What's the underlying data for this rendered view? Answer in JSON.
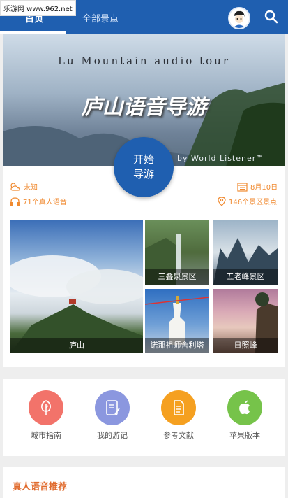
{
  "header": {
    "tabs": [
      {
        "label": "首页"
      },
      {
        "label": "全部景点"
      }
    ]
  },
  "watermark": {
    "text": "乐游网 www.962.net"
  },
  "banner": {
    "title_en": "Lu Mountain audio tour",
    "title_cn": "庐山语音导游",
    "credit": "by World Listener™"
  },
  "start_button": {
    "line1": "开始",
    "line2": "导游"
  },
  "info": {
    "weather": "未知",
    "date": "8月10日",
    "voices": "71个真人语音",
    "spots": "146个景区景点"
  },
  "photos": [
    {
      "caption": "庐山"
    },
    {
      "caption": "三叠泉景区"
    },
    {
      "caption": "五老峰景区"
    },
    {
      "caption": "诺那祖师舍利塔"
    },
    {
      "caption": "日照峰"
    }
  ],
  "features": [
    {
      "label": "城市指南",
      "icon": "tree-icon",
      "color": "#f2736a"
    },
    {
      "label": "我的游记",
      "icon": "notebook-icon",
      "color": "#8b97df"
    },
    {
      "label": "参考文献",
      "icon": "document-icon",
      "color": "#f5a020"
    },
    {
      "label": "苹果版本",
      "icon": "apple-icon",
      "color": "#76c34a"
    }
  ],
  "section": {
    "title": "真人语音推荐"
  },
  "colors": {
    "brand": "#1f5fb0",
    "accent": "#f08a30"
  }
}
